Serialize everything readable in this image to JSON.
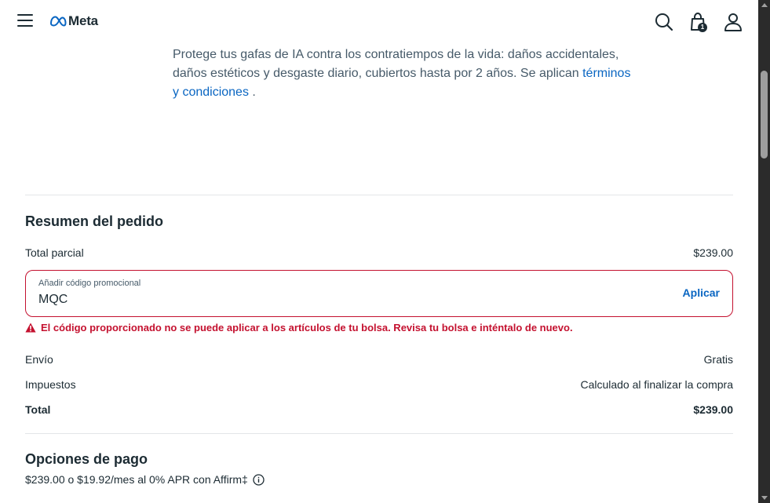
{
  "header": {
    "logo_text": "Meta",
    "cart_count": "1",
    "icons": [
      "menu-icon",
      "meta-logo-icon",
      "search-icon",
      "shopping-bag-icon",
      "user-icon"
    ]
  },
  "protection": {
    "text": "Protege tus gafas de IA contra los contratiempos de la vida: daños accidentales, daños estéticos y desgaste diario, cubiertos hasta por 2 años. Se aplican ",
    "link": "términos y condiciones",
    "suffix": " ."
  },
  "order_summary": {
    "title": "Resumen del pedido",
    "subtotal_label": "Total parcial",
    "subtotal_value": "$239.00",
    "promo": {
      "label": "Añadir código promocional",
      "value": "MQC",
      "apply_label": "Aplicar"
    },
    "error": "El código proporcionado no se puede aplicar a los artículos de tu bolsa. Revisa tu bolsa e inténtalo de nuevo.",
    "shipping_label": "Envío",
    "shipping_value": "Gratis",
    "taxes_label": "Impuestos",
    "taxes_value": "Calculado al finalizar la compra",
    "total_label": "Total",
    "total_value": "$239.00"
  },
  "payment": {
    "title": "Opciones de pago",
    "affirm_text": "$239.00 o $19.92/mes al 0% APR con Affirm‡"
  },
  "colors": {
    "text": "#1c2b33",
    "link": "#0a66c2",
    "error": "#c4112f",
    "divider": "#e3e6e8"
  }
}
